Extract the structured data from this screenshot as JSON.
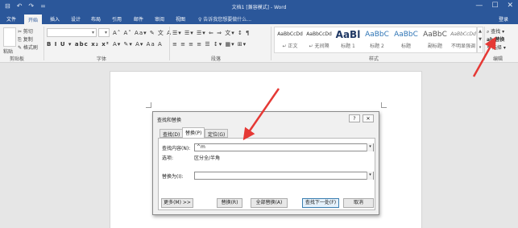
{
  "window": {
    "title": "文档1 [兼容模式] - Word",
    "qat_icons": [
      "save-icon",
      "undo-icon",
      "redo-icon",
      "customize-icon"
    ],
    "qat_glyphs": [
      "⊟",
      "↶",
      "↷",
      "="
    ],
    "controls": [
      "—",
      "☐",
      "✕"
    ]
  },
  "tabs": [
    {
      "label": "文件"
    },
    {
      "label": "开始"
    },
    {
      "label": "插入"
    },
    {
      "label": "设计"
    },
    {
      "label": "布局"
    },
    {
      "label": "引用"
    },
    {
      "label": "邮件"
    },
    {
      "label": "审阅"
    },
    {
      "label": "视图"
    }
  ],
  "tell_me": "♀ 告诉我您想要做什么...",
  "sign_in": "登录",
  "ribbon": {
    "groups": {
      "clipboard": "剪贴板",
      "font": "字体",
      "paragraph": "段落",
      "styles": "样式",
      "editing": "编辑"
    },
    "clipboard": {
      "paste": "粘贴",
      "cut": "✂ 剪切",
      "copy": "⎘ 复制",
      "format_painter": "✎ 格式刷"
    },
    "font_row1": "A˄ A˅ Aa▾ ✎ 文 A",
    "font_row2": "B I U ▾ abc x₂ x²",
    "font_row3": "A▾ ✎▾ A▾ Aa A",
    "para_row1": "☰▾ ☰▾ ☰▾ ⇐ ⇒ 文▾ ↕ ¶",
    "para_row2": "≡ ≡ ≡ ≡ ☰ ↕▾ ▦▾ ⊞▾",
    "styles": [
      {
        "preview": "AaBbCcDd",
        "name": "↵ 正文"
      },
      {
        "preview": "AaBbCcDd",
        "name": "↵ 无间隔"
      },
      {
        "preview": "AaBl",
        "name": "标题 1"
      },
      {
        "preview": "AaBbC",
        "name": "标题 2"
      },
      {
        "preview": "AaBbC",
        "name": "标题"
      },
      {
        "preview": "AaBbC",
        "name": "副标题"
      },
      {
        "preview": "AaBbCcDd",
        "name": "不明显强调"
      }
    ],
    "editing": {
      "find": "⌕ 查找 ▾",
      "replace": "ab 替换",
      "select": "↖ 选择 ▾"
    }
  },
  "dialog": {
    "title": "查找和替换",
    "help": "?",
    "close": "✕",
    "tabs": [
      {
        "label": "查找(D)"
      },
      {
        "label": "替换(P)"
      },
      {
        "label": "定位(G)"
      }
    ],
    "find_label": "查找内容(N):",
    "find_value": "^m",
    "options_label": "选项:",
    "options_value": "区分全/半角",
    "replace_label": "替换为(I):",
    "replace_value": "",
    "buttons": {
      "more": "更多(M) >>",
      "replace": "替换(R)",
      "replace_all": "全部替换(A)",
      "find_next": "查找下一处(F)",
      "cancel": "取消"
    }
  },
  "annotation_color": "#e53935"
}
